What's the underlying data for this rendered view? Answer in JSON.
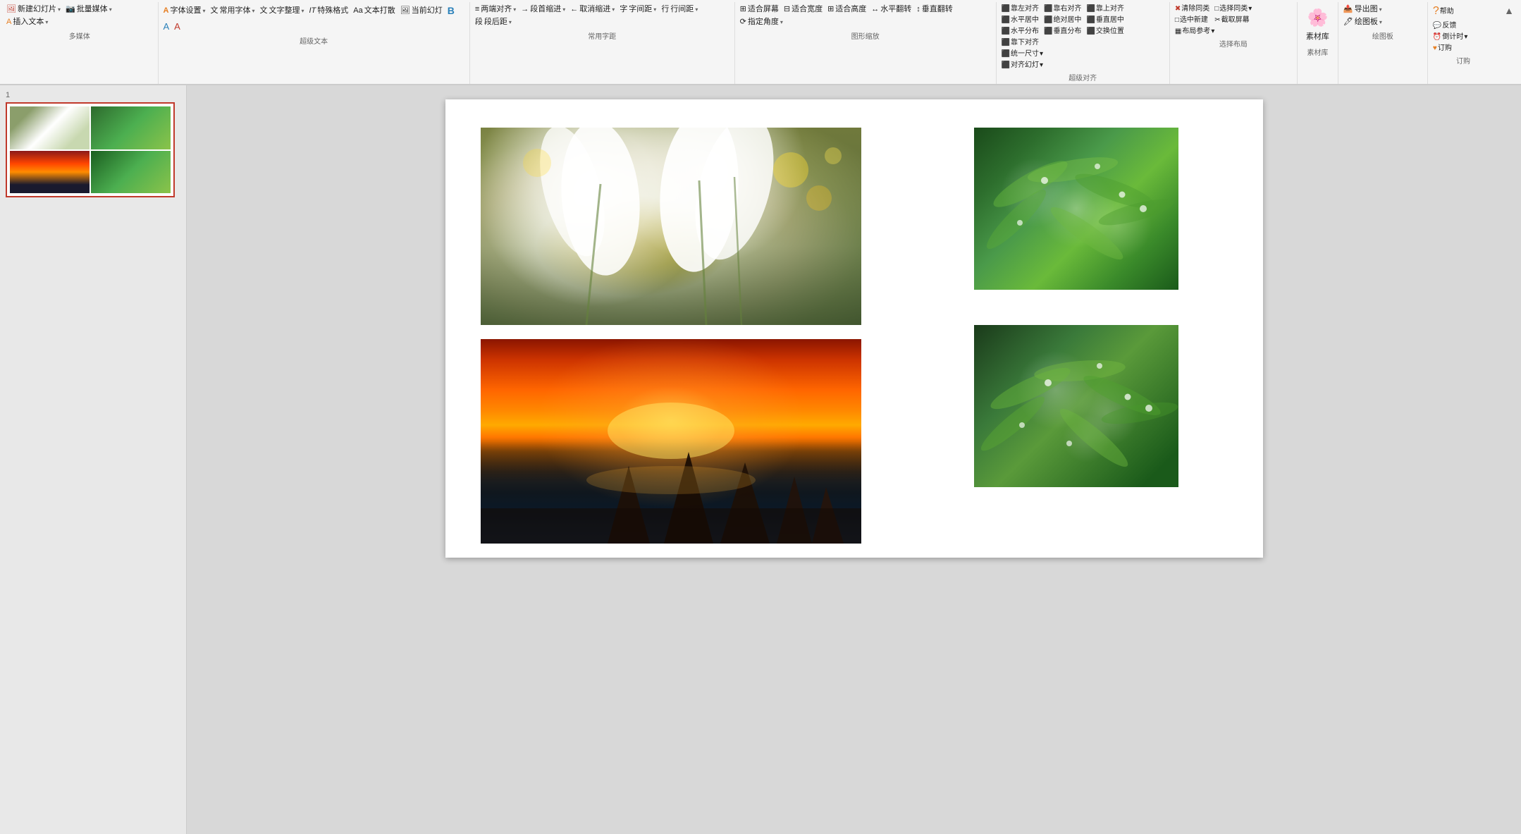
{
  "ribbon": {
    "sections": [
      {
        "id": "multimedia",
        "label": "多媒体",
        "buttons": [
          {
            "label": "新建幻灯片",
            "icon": "🖼",
            "hasArrow": true,
            "color": "red"
          },
          {
            "label": "批量媒体",
            "icon": "📷",
            "hasArrow": true,
            "color": "red"
          },
          {
            "label": "插入文本",
            "icon": "A",
            "hasArrow": true,
            "color": "orange"
          }
        ]
      },
      {
        "id": "super-text",
        "label": "超级文本",
        "buttons": [
          {
            "label": "字体设置",
            "icon": "A",
            "hasArrow": true
          },
          {
            "label": "常用字体",
            "icon": "文",
            "hasArrow": true
          },
          {
            "label": "文字整理",
            "icon": "文",
            "hasArrow": true
          },
          {
            "label": "特殊格式",
            "icon": "IT",
            "hasArrow": false
          },
          {
            "label": "文本打散",
            "icon": "Aa",
            "hasArrow": false
          },
          {
            "label": "当前幻灯",
            "icon": "🖼",
            "hasArrow": false
          },
          {
            "label": "B",
            "icon": "B",
            "hasArrow": false,
            "bold": true
          },
          {
            "label": "A",
            "icon": "A",
            "hasArrow": false
          },
          {
            "label": "A",
            "icon": "A",
            "hasArrow": false
          }
        ]
      },
      {
        "id": "common-spacing",
        "label": "常用字距",
        "buttons": [
          {
            "label": "两端对齐",
            "icon": "≡",
            "hasArrow": true
          },
          {
            "label": "段首缩进",
            "icon": "→",
            "hasArrow": true
          },
          {
            "label": "取消缩进",
            "icon": "←",
            "hasArrow": true
          },
          {
            "label": "字间距",
            "icon": "字",
            "hasArrow": true
          },
          {
            "label": "行间距",
            "icon": "行",
            "hasArrow": true
          },
          {
            "label": "段后距",
            "icon": "段",
            "hasArrow": true
          }
        ]
      },
      {
        "id": "zoom",
        "label": "图形缩放",
        "buttons": [
          {
            "label": "适合屏幕",
            "icon": "⊞",
            "hasArrow": false
          },
          {
            "label": "适合宽度",
            "icon": "⊟",
            "hasArrow": false
          },
          {
            "label": "适合高度",
            "icon": "⊞",
            "hasArrow": false
          },
          {
            "label": "水平翻转",
            "icon": "↔",
            "hasArrow": false
          },
          {
            "label": "垂直翻转",
            "icon": "↕",
            "hasArrow": false
          },
          {
            "label": "指定角度",
            "icon": "⟳",
            "hasArrow": true
          }
        ]
      },
      {
        "id": "super-align",
        "label": "超级对齐",
        "buttons": [
          {
            "label": "靠左对齐",
            "icon": "⬛",
            "hasArrow": false
          },
          {
            "label": "水平居中",
            "icon": "⬛",
            "hasArrow": false
          },
          {
            "label": "水平分布",
            "icon": "⬛",
            "hasArrow": false
          },
          {
            "label": "靠右对齐",
            "icon": "⬛",
            "hasArrow": false
          },
          {
            "label": "绝对居中",
            "icon": "⬛",
            "hasArrow": false
          },
          {
            "label": "垂直分布",
            "icon": "⬛",
            "hasArrow": false
          },
          {
            "label": "靠上对齐",
            "icon": "⬛",
            "hasArrow": false
          },
          {
            "label": "垂直居中",
            "icon": "⬛",
            "hasArrow": false
          },
          {
            "label": "交换位置",
            "icon": "⬛",
            "hasArrow": false
          },
          {
            "label": "靠下对齐",
            "icon": "⬛",
            "hasArrow": false
          },
          {
            "label": "统一尺寸",
            "icon": "⬛",
            "hasArrow": true
          },
          {
            "label": "对齐幻灯",
            "icon": "⬛",
            "hasArrow": true
          }
        ]
      },
      {
        "id": "select-layout",
        "label": "选择布局",
        "buttons": [
          {
            "label": "清除同类",
            "icon": "✖",
            "hasArrow": false
          },
          {
            "label": "选中新建",
            "icon": "□",
            "hasArrow": false
          },
          {
            "label": "选择同类",
            "icon": "□",
            "hasArrow": true
          },
          {
            "label": "截取屏幕",
            "icon": "✂",
            "hasArrow": false
          },
          {
            "label": "布局参考",
            "icon": "▦",
            "hasArrow": true
          }
        ]
      },
      {
        "id": "material",
        "label": "素材库",
        "buttons": [
          {
            "label": "素材库",
            "icon": "🌸",
            "hasArrow": false
          }
        ]
      },
      {
        "id": "drawing-board",
        "label": "绘图板",
        "buttons": [
          {
            "label": "导出图",
            "icon": "📤",
            "hasArrow": true
          },
          {
            "label": "绘图板",
            "icon": "🖊",
            "hasArrow": true
          }
        ]
      },
      {
        "id": "order",
        "label": "订购",
        "buttons": [
          {
            "label": "帮助",
            "icon": "?",
            "hasArrow": false,
            "color": "orange"
          },
          {
            "label": "反馈",
            "icon": "💬",
            "hasArrow": false,
            "color": "green"
          },
          {
            "label": "倒计时",
            "icon": "⏰",
            "hasArrow": true,
            "color": "orange"
          },
          {
            "label": "订购",
            "icon": "♥",
            "hasArrow": false,
            "color": "orange"
          }
        ]
      }
    ],
    "collapse_button": "▲"
  },
  "slide": {
    "number": "1",
    "images": [
      {
        "id": "img-flowers",
        "alt": "White crocus flowers with water droplets in golden bokeh light",
        "position": "top-left-large"
      },
      {
        "id": "img-green1",
        "alt": "Green leaves with water droplets close-up",
        "position": "top-right-small"
      },
      {
        "id": "img-sunset",
        "alt": "Dramatic ocean sunset with rock formations",
        "position": "bottom-left-large"
      },
      {
        "id": "img-green2",
        "alt": "Green leaves with water droplets close-up 2",
        "position": "bottom-right-small"
      }
    ]
  }
}
